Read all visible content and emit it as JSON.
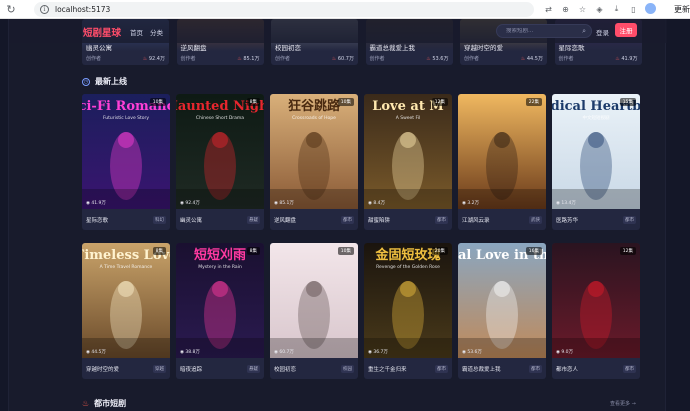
{
  "browser": {
    "url": "localhost:5173",
    "update_label": "更新"
  },
  "header": {
    "logo": "短剧星球",
    "nav": [
      "首页",
      "分类"
    ],
    "search_placeholder": "搜索短剧...",
    "login": "登录",
    "register": "注册"
  },
  "hero_strip": [
    {
      "title": "幽灵公寓",
      "author": "创作者",
      "views": "92.4万",
      "color": "#3b4a7a"
    },
    {
      "title": "逆风翻盘",
      "author": "创作者",
      "views": "85.1万",
      "color": "#6a4b3a"
    },
    {
      "title": "校园初恋",
      "author": "创作者",
      "views": "60.7万",
      "color": "#6b6f7a"
    },
    {
      "title": "霸道总裁爱上我",
      "author": "创作者",
      "views": "53.6万",
      "color": "#3f3530"
    },
    {
      "title": "穿越时空的爱",
      "author": "创作者",
      "views": "44.5万",
      "color": "#7a6a4a"
    },
    {
      "title": "星际恋歌",
      "author": "创作者",
      "views": "41.9万",
      "color": "#3a2e5a"
    }
  ],
  "sections": {
    "new_releases": "最新上线",
    "urban": "都市短剧",
    "see_more": "查看更多 →"
  },
  "row1": [
    {
      "title": "星际恋歌",
      "episodes": "10集",
      "views": "41.9万",
      "genre": "科幻",
      "poster_text": "Sci-Fi Romance",
      "poster_sub": "Futuristic Love Story",
      "bg1": "#1b1f5c",
      "bg2": "#3a1470",
      "accent": "#ff3fd6"
    },
    {
      "title": "幽灵公寓",
      "episodes": "8集",
      "views": "92.4万",
      "genre": "悬疑",
      "poster_text": "Haunted Night",
      "poster_sub": "Chinese Short Drama",
      "bg1": "#0e1a14",
      "bg2": "#1f2a24",
      "accent": "#e8262e"
    },
    {
      "title": "逆风翻盘",
      "episodes": "10集",
      "views": "85.1万",
      "genre": "都市",
      "poster_text": "狂谷跳路",
      "poster_sub": "Crossroads of Hope",
      "bg1": "#d9b07a",
      "bg2": "#8a5a36",
      "accent": "#4a2a10"
    },
    {
      "title": "甜蜜陷阱",
      "episodes": "12集",
      "views": "8.4万",
      "genre": "都市",
      "poster_text": "Love at M",
      "poster_sub": "A Sweet Fil",
      "bg1": "#3a2a1a",
      "bg2": "#7a5a2a",
      "accent": "#ffe9b0"
    },
    {
      "title": "江湖风云录",
      "episodes": "22集",
      "views": "3.2万",
      "genre": "武侠",
      "poster_text": "",
      "poster_sub": "",
      "bg1": "#f0b860",
      "bg2": "#6a3a1a",
      "accent": "#2a1a10"
    },
    {
      "title": "医路芳华",
      "episodes": "15集",
      "views": "13.4万",
      "genre": "都市",
      "poster_text": "Medical Heartbeat",
      "poster_sub": "中文短短视剧",
      "bg1": "#eaf2f8",
      "bg2": "#c9d8e6",
      "accent": "#1b3a6a"
    }
  ],
  "row2": [
    {
      "title": "穿越时空的爱",
      "episodes": "8集",
      "views": "44.5万",
      "genre": "穿越",
      "poster_text": "Timeless Love",
      "poster_sub": "A Time Travel Romance",
      "bg1": "#c9a36a",
      "bg2": "#6a4a2a",
      "accent": "#fff3d0"
    },
    {
      "title": "暗夜追踪",
      "episodes": "8集",
      "views": "38.8万",
      "genre": "悬疑",
      "poster_text": "短短刈雨",
      "poster_sub": "Mystery in the Rain",
      "bg1": "#1a1030",
      "bg2": "#2a1a50",
      "accent": "#ff3aa0"
    },
    {
      "title": "校园初恋",
      "episodes": "10集",
      "views": "60.7万",
      "genre": "校园",
      "poster_text": "",
      "poster_sub": "",
      "bg1": "#f3e6ea",
      "bg2": "#d8c6cc",
      "accent": "#5a4a4a"
    },
    {
      "title": "重生之千金归来",
      "episodes": "20集",
      "views": "36.7万",
      "genre": "都市",
      "poster_text": "金固短玫瑰",
      "poster_sub": "Revenge of the Golden Rose",
      "bg1": "#1a140e",
      "bg2": "#4a3a1a",
      "accent": "#f0c040"
    },
    {
      "title": "霸道总裁爱上我",
      "episodes": "16集",
      "views": "53.6万",
      "genre": "都市",
      "poster_text": "ernal Love in the S",
      "poster_sub": "",
      "bg1": "#8aa6c0",
      "bg2": "#c08a5a",
      "accent": "#ffffff"
    },
    {
      "title": "都市恋人",
      "episodes": "12集",
      "views": "9.0万",
      "genre": "都市",
      "poster_text": "",
      "poster_sub": "",
      "bg1": "#2a1420",
      "bg2": "#6a1a2a",
      "accent": "#e01a2a"
    }
  ]
}
